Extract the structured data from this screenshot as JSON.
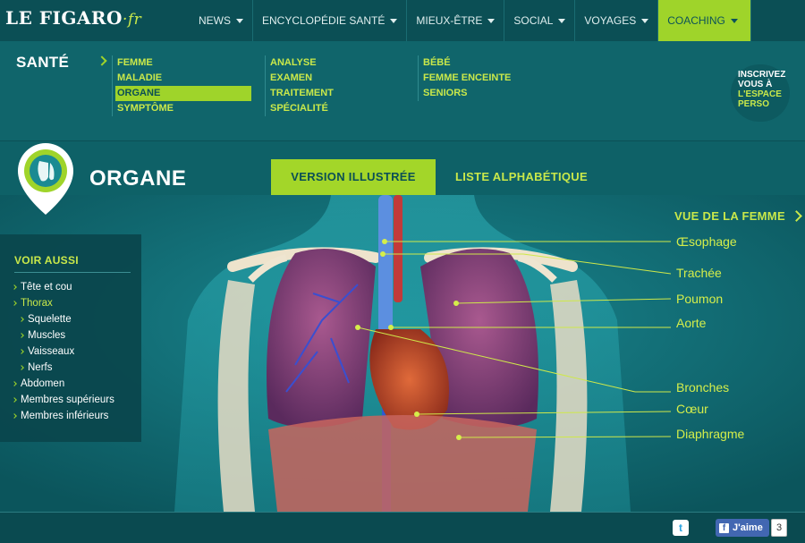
{
  "logo": {
    "main": "LE FIGARO",
    "suffix": "·fr"
  },
  "nav": [
    {
      "label": "NEWS"
    },
    {
      "label": "ENCYCLOPÉDIE SANTÉ"
    },
    {
      "label": "MIEUX-ÊTRE"
    },
    {
      "label": "SOCIAL"
    },
    {
      "label": "VOYAGES"
    },
    {
      "label": "COACHING"
    }
  ],
  "menu": {
    "title": "SANTÉ",
    "col1": [
      "FEMME",
      "MALADIE",
      "ORGANE",
      "SYMPTÔME"
    ],
    "col2": [
      "ANALYSE",
      "EXAMEN",
      "TRAITEMENT",
      "SPÉCIALITÉ"
    ],
    "col3": [
      "BÉBÉ",
      "FEMME ENCEINTE",
      "SENIORS"
    ],
    "selected": "ORGANE"
  },
  "inscrivez": {
    "line1": "INSCRIVEZ",
    "line2": "VOUS À",
    "line3": "L'ESPACE",
    "line4": "PERSO"
  },
  "page": {
    "title": "ORGANE"
  },
  "tabs": {
    "illustree": "VERSION ILLUSTRÉE",
    "alphabetique": "LISTE ALPHABÉTIQUE"
  },
  "voir_aussi": {
    "title": "VOIR AUSSI",
    "items": [
      {
        "label": "Tête et cou"
      },
      {
        "label": "Thorax"
      },
      {
        "label": "Squelette"
      },
      {
        "label": "Muscles"
      },
      {
        "label": "Vaisseaux"
      },
      {
        "label": "Nerfs"
      },
      {
        "label": "Abdomen"
      },
      {
        "label": "Membres supérieurs"
      },
      {
        "label": "Membres inférieurs"
      }
    ]
  },
  "vue": "VUE DE LA FEMME",
  "labels": [
    "Œsophage",
    "Trachée",
    "Poumon",
    "Aorte",
    "Bronches",
    "Cœur",
    "Diaphragme"
  ],
  "footer": {
    "twitter": "t",
    "like_label": "J'aime",
    "like_count": "3",
    "fb_icon": "f"
  }
}
